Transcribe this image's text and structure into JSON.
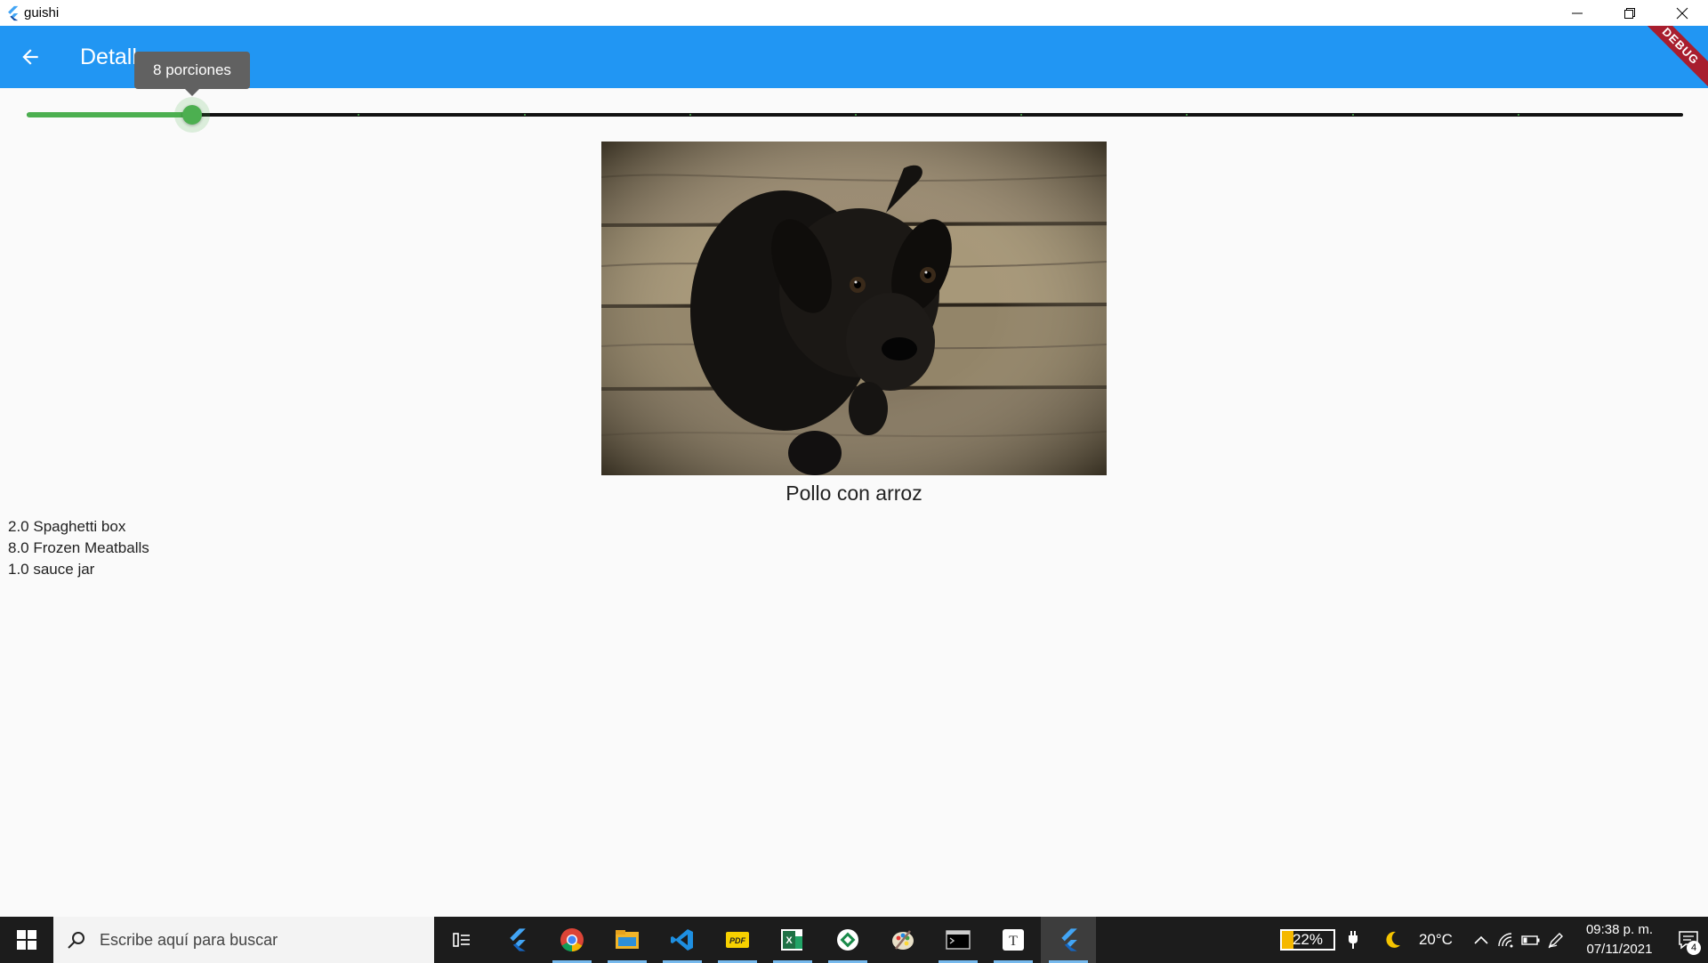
{
  "window": {
    "title": "guishi",
    "controls": [
      "minimize-icon",
      "restore-icon",
      "close-icon"
    ]
  },
  "appbar": {
    "title": "Detall",
    "back_icon": "arrow-back-icon",
    "color": "#2196f3",
    "debug_banner": "DEBUG"
  },
  "slider": {
    "tooltip": "8 porciones",
    "value": 8,
    "min": 0,
    "max": 80,
    "divisions": 10,
    "active_color": "#4caf50"
  },
  "recipe": {
    "name": "Pollo con arroz",
    "ingredients": [
      "2.0 Spaghetti box",
      "8.0 Frozen Meatballs",
      "1.0 sauce jar"
    ]
  },
  "taskbar": {
    "search_placeholder": "Escribe aquí para buscar",
    "apps": [
      "task-view-icon",
      "flutter-icon",
      "chrome-icon",
      "file-explorer-icon",
      "vscode-icon",
      "pdf-icon",
      "excel-icon",
      "app-icon",
      "paint-icon",
      "terminal-icon",
      "typora-icon",
      "flutter-app-icon"
    ],
    "battery": "22%",
    "temperature": "20°C",
    "time": "09:38 p. m.",
    "date": "07/11/2021",
    "notifications": "4"
  }
}
